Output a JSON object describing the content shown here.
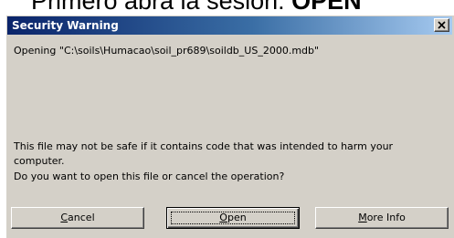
{
  "heading": {
    "text": "Primero abra la sesión:",
    "strong": "OPEN"
  },
  "dialog": {
    "title": "Security Warning",
    "opening_text": "Opening \"C:\\soils\\Humacao\\soil_pr689\\soildb_US_2000.mdb\"",
    "warning_text": "This file may not be safe if it contains code that was intended to harm your computer.",
    "question_text": "Do you want to open this file or cancel the operation?",
    "close_icon": "close-icon",
    "buttons": {
      "cancel": {
        "mnemonic": "C",
        "rest": "ancel"
      },
      "open": {
        "mnemonic": "O",
        "rest": "pen"
      },
      "more_info": {
        "mnemonic": "M",
        "rest": "ore Info"
      }
    }
  },
  "colors": {
    "dialog_face": "#d4d0c8",
    "titlebar_start": "#0a246a",
    "titlebar_end": "#a6caf0",
    "title_text": "#ffffff"
  }
}
